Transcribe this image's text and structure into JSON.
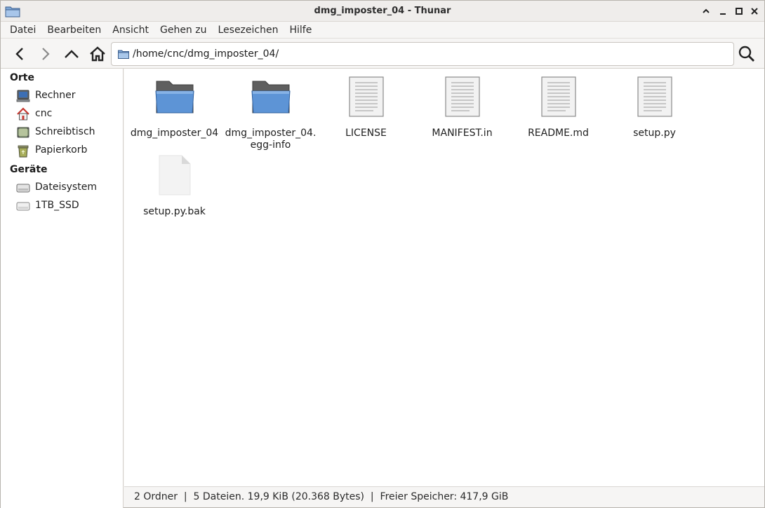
{
  "window": {
    "title": "dmg_imposter_04 - Thunar"
  },
  "menubar": {
    "items": [
      "Datei",
      "Bearbeiten",
      "Ansicht",
      "Gehen zu",
      "Lesezeichen",
      "Hilfe"
    ]
  },
  "toolbar": {
    "location_path": "/home/cnc/dmg_imposter_04/",
    "icons": [
      "back-icon",
      "forward-icon",
      "up-icon",
      "home-icon",
      "search-icon"
    ]
  },
  "sidebar": {
    "places_heading": "Orte",
    "places": [
      {
        "label": "Rechner",
        "icon": "computer-icon"
      },
      {
        "label": "cnc",
        "icon": "home-folder-icon"
      },
      {
        "label": "Schreibtisch",
        "icon": "desktop-icon"
      },
      {
        "label": "Papierkorb",
        "icon": "trash-icon"
      }
    ],
    "devices_heading": "Geräte",
    "devices": [
      {
        "label": "Dateisystem",
        "icon": "drive-icon"
      },
      {
        "label": "1TB_SSD",
        "icon": "drive-icon"
      }
    ]
  },
  "files": [
    {
      "name_line1": "dmg_imposter_04",
      "name_line2": "",
      "type": "folder"
    },
    {
      "name_line1": "dmg_imposter_04.",
      "name_line2": "egg-info",
      "type": "folder"
    },
    {
      "name_line1": "LICENSE",
      "name_line2": "",
      "type": "text"
    },
    {
      "name_line1": "MANIFEST.in",
      "name_line2": "",
      "type": "text"
    },
    {
      "name_line1": "README.md",
      "name_line2": "",
      "type": "text"
    },
    {
      "name_line1": "setup.py",
      "name_line2": "",
      "type": "text"
    },
    {
      "name_line1": "setup.py.bak",
      "name_line2": "",
      "type": "blank"
    }
  ],
  "statusbar": {
    "text": "2 Ordner  |  5 Dateien. 19,9 KiB (20.368 Bytes)  |  Freier Speicher: 417,9 GiB"
  },
  "colors": {
    "folder_blue": "#5d94d6",
    "folder_dark": "#5f5f5f",
    "home_red": "#c7372f"
  }
}
